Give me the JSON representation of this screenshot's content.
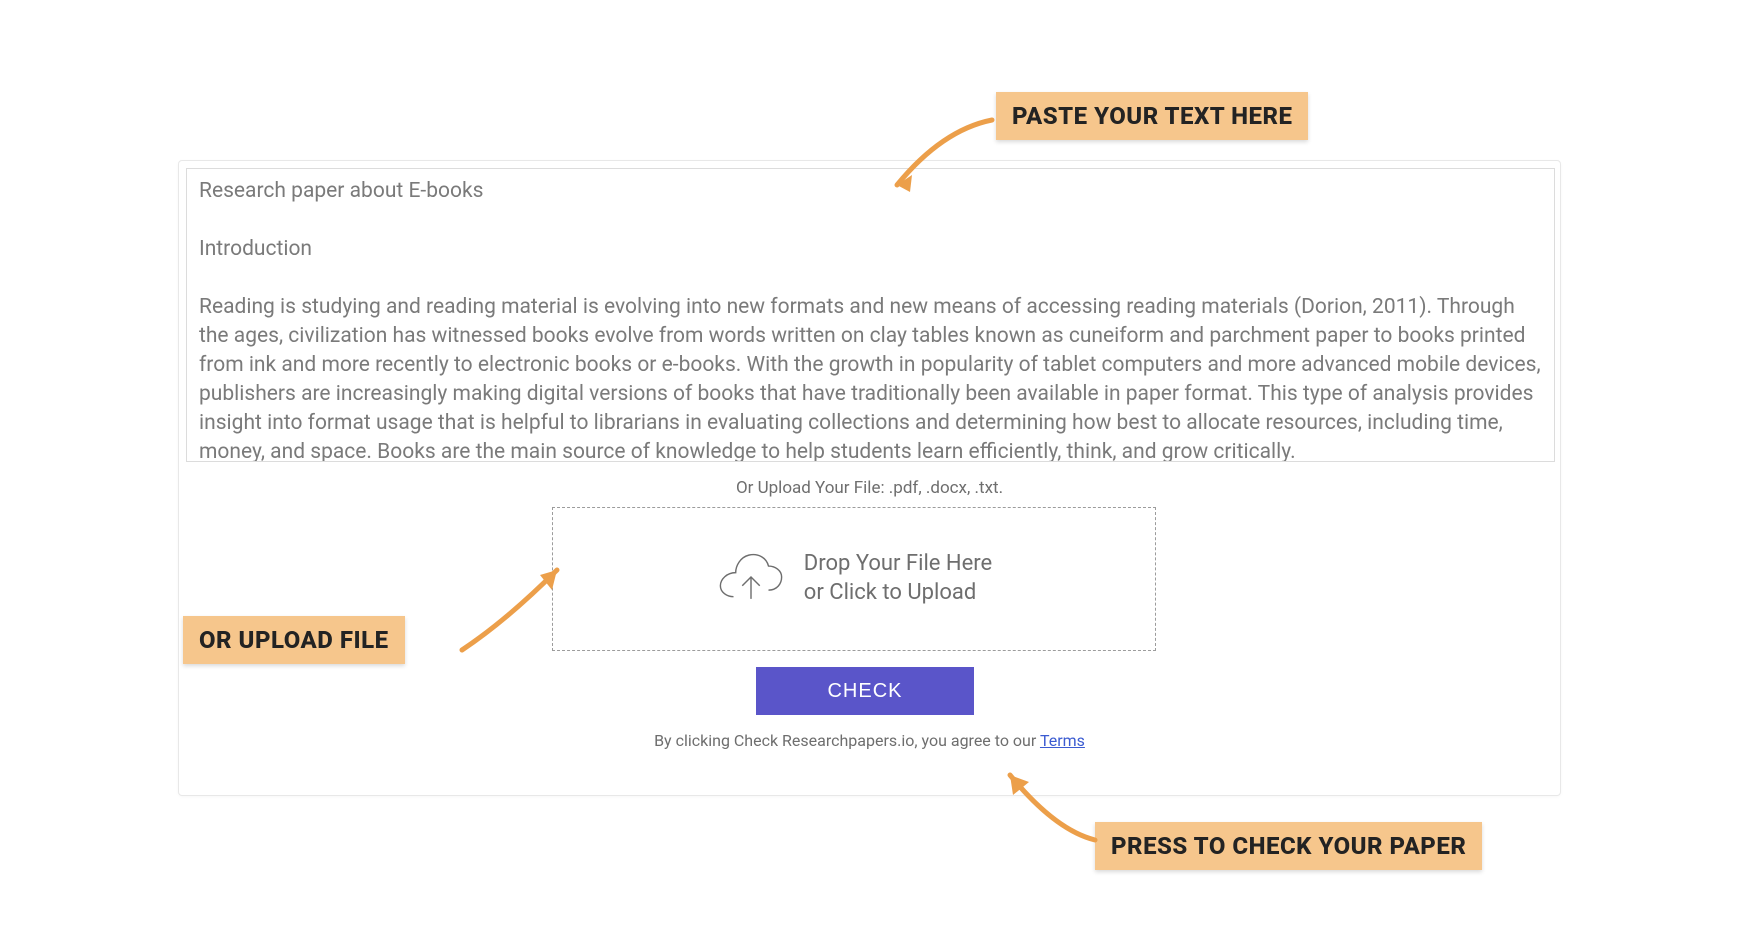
{
  "textarea": {
    "value": "Research paper about E-books\n\nIntroduction\n\nReading is studying and reading material is evolving into new formats and new means of accessing reading materials (Dorion, 2011). Through the ages, civilization has witnessed books evolve from words written on clay tables known as cuneiform and parchment paper to books printed from ink and more recently to electronic books or e-books. With the growth in popularity of tablet computers and more advanced mobile devices, publishers are increasingly making digital versions of books that have traditionally been available in paper format. This type of analysis provides insight into format usage that is helpful to librarians in evaluating collections and determining how best to allocate resources, including time, money, and space. Books are the main source of knowledge to help students learn efficiently, think, and grow critically.\n\nThrough the evolution of the human mind and activities, man creates and evolves through the use of technology. Students , as well as"
  },
  "upload_hint": "Or Upload Your File: .pdf, .docx, .txt.",
  "dropzone": {
    "line1": "Drop Your File Here",
    "line2": "or Click to Upload"
  },
  "check_button": "CHECK",
  "terms_prefix": "By clicking Check Researchpapers.io, you agree to our ",
  "terms_link": "Terms",
  "annotations": {
    "paste": "PASTE YOUR TEXT HERE",
    "upload": "OR UPLOAD FILE",
    "press": "PRESS TO CHECK YOUR PAPER"
  }
}
